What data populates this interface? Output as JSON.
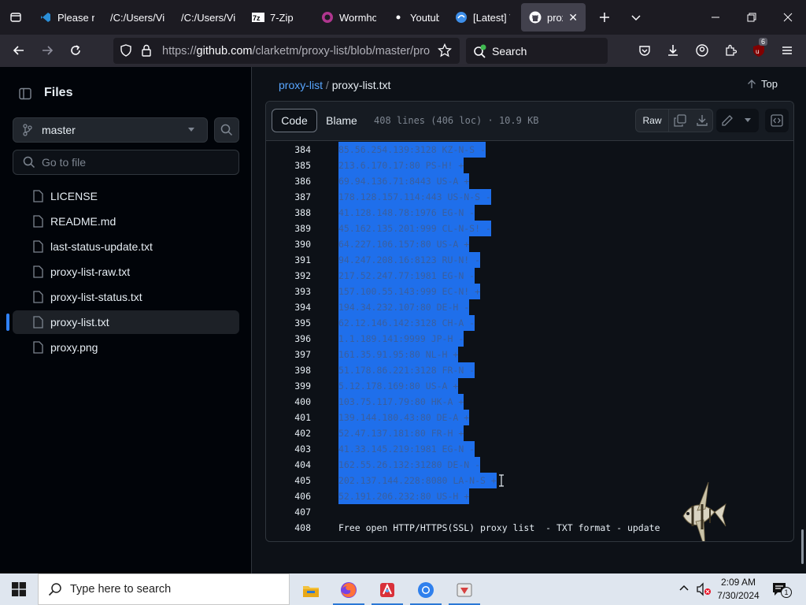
{
  "browser": {
    "tabs": [
      {
        "label": "Please re",
        "icon": "vscode-icon"
      },
      {
        "label": "/C:/Users/Vi",
        "icon": "file-icon"
      },
      {
        "label": "/C:/Users/Vi",
        "icon": "file-icon"
      },
      {
        "label": "7-Zip",
        "icon": "7zip-icon"
      },
      {
        "label": "Wormho",
        "icon": "wormhole-icon"
      },
      {
        "label": "Youtube",
        "icon": "dot-icon"
      },
      {
        "label": "[Latest] V",
        "icon": "vpn-icon"
      },
      {
        "label": "proxy",
        "icon": "github-icon"
      }
    ],
    "url_prefix": "https://",
    "url_domain": "github.com",
    "url_rest": "/clarketm/proxy-list/blob/master/pro",
    "search_label": "Search",
    "extension_badge": "6"
  },
  "sidebar": {
    "title": "Files",
    "branch": "master",
    "goto_placeholder": "Go to file",
    "files": [
      {
        "name": "LICENSE"
      },
      {
        "name": "README.md"
      },
      {
        "name": "last-status-update.txt"
      },
      {
        "name": "proxy-list-raw.txt"
      },
      {
        "name": "proxy-list-status.txt"
      },
      {
        "name": "proxy-list.txt"
      },
      {
        "name": "proxy.png"
      }
    ]
  },
  "main": {
    "repo": "proxy-list",
    "separator": "/",
    "filename": "proxy-list.txt",
    "top_label": "Top",
    "code_tab": "Code",
    "blame_tab": "Blame",
    "file_info": "408 lines (406 loc) · 10.9 KB",
    "raw_label": "Raw"
  },
  "code_lines": [
    {
      "n": "384",
      "text": "85.56.254.139:3128 KZ-N-S -"
    },
    {
      "n": "385",
      "text": "213.6.170.17:80 PS-H! +"
    },
    {
      "n": "386",
      "text": "69.94.136.71:8443 US-A +"
    },
    {
      "n": "387",
      "text": "178.128.157.114:443 US-N-S -"
    },
    {
      "n": "388",
      "text": "41.128.148.78:1976 EG-N -"
    },
    {
      "n": "389",
      "text": "45.162.135.201:999 CL-N-S! -"
    },
    {
      "n": "390",
      "text": "64.227.106.157:80 US-A +"
    },
    {
      "n": "391",
      "text": "94.247.208.16:8123 RU-N! -"
    },
    {
      "n": "392",
      "text": "217.52.247.77:1981 EG-N -"
    },
    {
      "n": "393",
      "text": "157.100.55.143:999 EC-N! +"
    },
    {
      "n": "394",
      "text": "194.34.232.107:80 DE-H -"
    },
    {
      "n": "395",
      "text": "62.12.146.142:3128 CH-A -"
    },
    {
      "n": "396",
      "text": "1.1.189.141:9999 JP-H -"
    },
    {
      "n": "397",
      "text": "161.35.91.95:80 NL-H +"
    },
    {
      "n": "398",
      "text": "51.178.86.221:3128 FR-N -"
    },
    {
      "n": "399",
      "text": "5.12.178.169:80 US-A +"
    },
    {
      "n": "400",
      "text": "103.75.117.79:80 HK-A +"
    },
    {
      "n": "401",
      "text": "139.144.180.43:80 DE-A +"
    },
    {
      "n": "402",
      "text": "52.47.137.181:80 FR-H +"
    },
    {
      "n": "403",
      "text": "41.33.145.219:1981 EG-N -"
    },
    {
      "n": "404",
      "text": "162.55.26.132:31280 DE-N -"
    },
    {
      "n": "405",
      "text": "202.137.144.228:8080 LA-N-S +"
    },
    {
      "n": "406",
      "text": "52.191.206.232:80 US-H +"
    },
    {
      "n": "407",
      "text": ""
    },
    {
      "n": "408",
      "text": "Free open HTTP/HTTPS(SSL) proxy list  - TXT format - update"
    }
  ],
  "taskbar": {
    "search_placeholder": "Type here to search",
    "time": "2:09 AM",
    "date": "7/30/2024",
    "notification_count": "1"
  }
}
